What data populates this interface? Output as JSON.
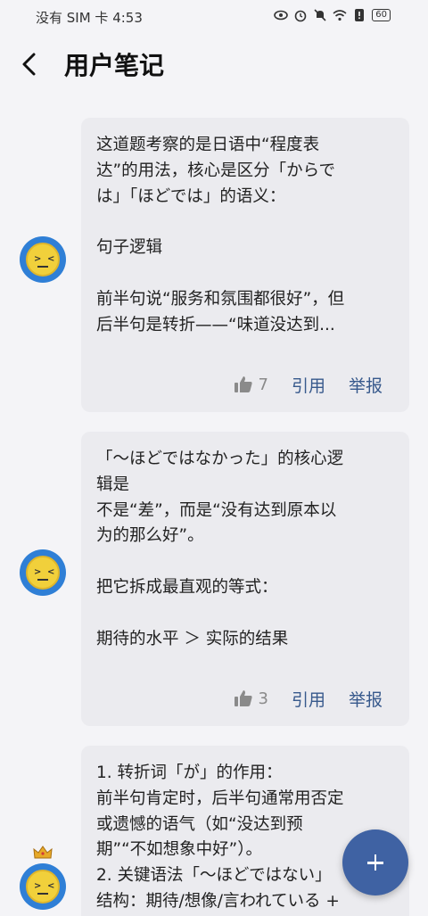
{
  "status_bar": {
    "left_text": "没有 SIM 卡 4:53",
    "battery": "60",
    "icons": [
      "eye-icon",
      "alarm-icon",
      "mute-icon",
      "wifi-icon",
      "alert-icon",
      "battery-icon"
    ]
  },
  "header": {
    "title": "用户笔记",
    "back_icon": "back-arrow-icon"
  },
  "posts": [
    {
      "avatar": "emoji-face-avatar",
      "lines": [
        "这道题考察的是日语中“程度表",
        "达”的用法，核心是区分「からで",
        "は」「ほどでは」的语义：",
        "",
        "句子逻辑",
        "",
        "前半句说“服务和氛围都很好”，但",
        "后半句是转折——“味道没达到..."
      ],
      "likes": "7",
      "quote_label": "引用",
      "report_label": "举报"
    },
    {
      "avatar": "emoji-face-avatar",
      "lines": [
        "「～ほどではなかった」的核心逻",
        "辑是",
        "不是“差”，而是“没有达到原本以",
        "为的那么好”。",
        "",
        "把它拆成最直观的等式：",
        "",
        "期待的水平 ＞ 实际的结果"
      ],
      "likes": "3",
      "quote_label": "引用",
      "report_label": "举报"
    },
    {
      "avatar": "emoji-face-avatar-crowned",
      "lines": [
        "1. 转折词「が」的作用：",
        "前半句肯定时，后半句通常用否定",
        "或遗憾的语气（如“没达到预",
        "期”“不如想象中好”）。",
        "2. 关键语法「～ほどではない」",
        "结构：期待/想像/言われている +"
      ]
    }
  ],
  "fab": {
    "icon": "plus-icon"
  },
  "colors": {
    "accent": "#3f62a3",
    "link": "#37598c",
    "card": "#ebebef",
    "background": "#f4f4f7"
  }
}
